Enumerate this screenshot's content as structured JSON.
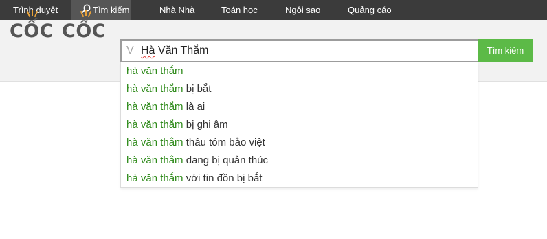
{
  "nav": {
    "items": [
      {
        "label": "Trình duyệt",
        "active": false
      },
      {
        "label": "Tìm kiếm",
        "active": true,
        "icon": "search-icon"
      },
      {
        "label": "Nhà Nhà",
        "active": false
      },
      {
        "label": "Toán học",
        "active": false
      },
      {
        "label": "Ngôi sao",
        "active": false
      },
      {
        "label": "Quảng cáo",
        "active": false
      }
    ]
  },
  "logo": {
    "word1": "CỐC",
    "word2": "CỐC",
    "spark_color": "#e8a23a"
  },
  "search": {
    "input_prefix_icon": "V",
    "query_first": "Hà",
    "query_rest": " Văn Thắm",
    "button_label": "Tìm kiếm"
  },
  "suggestions": [
    {
      "typed": "hà văn thắm",
      "completion": ""
    },
    {
      "typed": "hà văn thắm",
      "completion": " bị bắt"
    },
    {
      "typed": "hà văn thắm",
      "completion": " là ai"
    },
    {
      "typed": "hà văn thắm",
      "completion": " bị ghi âm"
    },
    {
      "typed": "hà văn thắm",
      "completion": " thâu tóm bảo việt"
    },
    {
      "typed": "hà văn thắm",
      "completion": " đang bị quản thúc"
    },
    {
      "typed": "hà văn thắm",
      "completion": " với tin đồn bị bắt"
    }
  ],
  "colors": {
    "nav_bg": "#3b3b3b",
    "accent_green": "#5cba47",
    "suggestion_green": "#2e8a1a"
  }
}
